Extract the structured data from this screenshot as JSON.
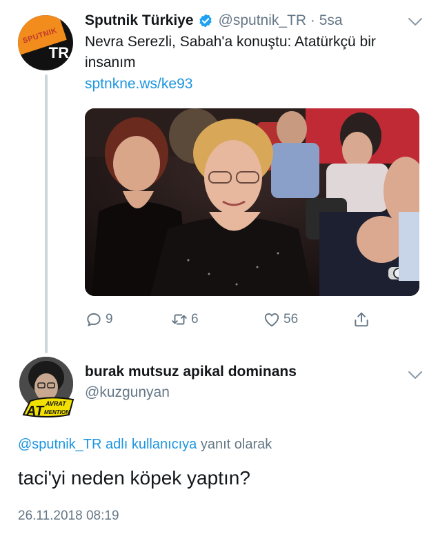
{
  "tweet": {
    "avatar": {
      "label_top": "SPUTNIK",
      "label_bottom": "TR",
      "colors": {
        "orange": "#f28c1c",
        "black": "#111111"
      }
    },
    "display_name": "Sputnik Türkiye",
    "handle_time": "@sputnik_TR · 5sa",
    "text": "Nevra Serezli, Sabah'a konuştu: Atatürkçü bir insanım",
    "link": "sptnkne.ws/ke93",
    "actions": {
      "reply": {
        "icon": "reply-icon",
        "count": "9"
      },
      "retweet": {
        "icon": "retweet-icon",
        "count": "6"
      },
      "like": {
        "icon": "heart-icon",
        "count": "56"
      },
      "share": {
        "icon": "share-icon"
      }
    }
  },
  "reply": {
    "display_name": "burak mutsuz apikal dominans",
    "handle": "@kuzgunyan",
    "sticker": {
      "line1": "AVRAT",
      "big": "AT",
      "line2": "MENTION"
    },
    "reply_to_mention": "@sputnik_TR adlı kullanıcıya",
    "reply_to_suffix": " yanıt olarak",
    "text": "taci'yi neden köpek yaptın?",
    "timestamp": "26.11.2018 08:19"
  },
  "colors": {
    "link": "#1b95e0",
    "muted": "#657786",
    "text": "#14171a",
    "thread_line": "#ccd6dd"
  }
}
